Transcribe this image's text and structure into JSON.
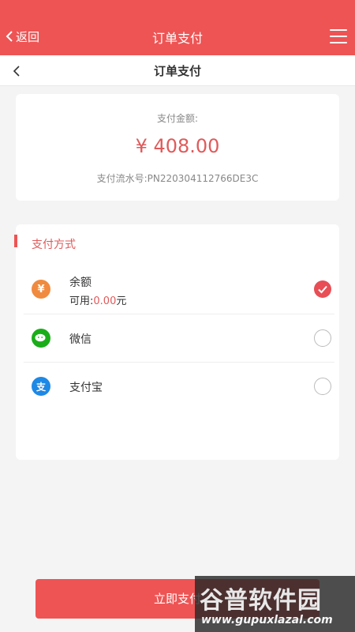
{
  "topbar": {
    "back_label": "返回",
    "title": "订单支付"
  },
  "subbar": {
    "title": "订单支付"
  },
  "amount": {
    "label": "支付金额:",
    "value": "¥ 408.00",
    "serial": "支付流水号:PN220304112766DE3C"
  },
  "methods": {
    "header": "支付方式",
    "balance": {
      "name": "余额",
      "available_label": "可用:",
      "available_value": "0.00",
      "unit": "元",
      "icon_glyph": "¥",
      "selected": true
    },
    "wechat": {
      "name": "微信",
      "selected": false
    },
    "alipay": {
      "name": "支付宝",
      "icon_glyph": "支",
      "selected": false
    }
  },
  "pay_button": {
    "label": "立即支付"
  },
  "watermark": {
    "brand": "谷普软件园",
    "url": "www.gupuxlazal.com"
  },
  "colors": {
    "brand_red": "#ee5454",
    "amount_red": "#e05a5a",
    "balance_icon": "#f08a3e",
    "wechat_icon": "#1aad19",
    "alipay_icon": "#1e88e5"
  }
}
